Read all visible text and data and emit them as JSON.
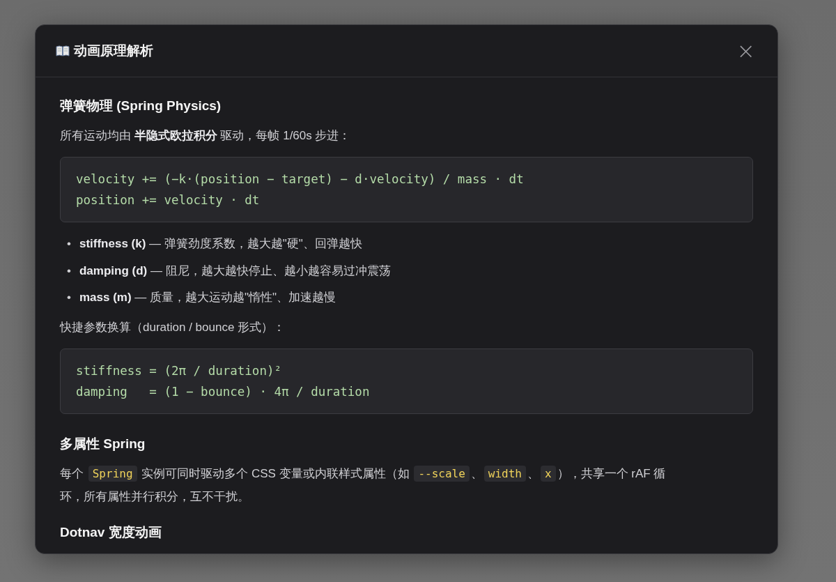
{
  "dialog": {
    "title": "动画原理解析",
    "close": "×"
  },
  "content": [
    {
      "kind": "heading",
      "text": "弹簧物理 (Spring Physics)"
    },
    {
      "kind": "paragraph",
      "text": "所有运动均由 **半隐式欧拉积分** 驱动，每帧 1/60s 步进："
    },
    {
      "kind": "code",
      "lines": [
        "velocity += (−k·(position − target) − d·velocity) / mass · dt",
        "position += velocity · dt"
      ]
    },
    {
      "kind": "list",
      "bullet": "•",
      "items": [
        "**stiffness (k)** — 弹簧劲度系数，越大越\"硬\"、回弹越快",
        "**damping (d)** — 阻尼，越大越快停止、越小越容易过冲震荡",
        "**mass (m)** — 质量，越大运动越\"惰性\"、加速越慢"
      ]
    },
    {
      "kind": "paragraph",
      "text": "快捷参数换算（duration / bounce 形式）："
    },
    {
      "kind": "code",
      "lines": [
        "stiffness = (2π / duration)²",
        "damping   = (1 − bounce) · 4π / duration"
      ]
    },
    {
      "kind": "heading",
      "text": "多属性 Spring"
    },
    {
      "kind": "mixed",
      "parts": [
        {
          "kind": "text",
          "text": "每个 "
        },
        {
          "kind": "code",
          "text": "Spring"
        },
        {
          "kind": "text",
          "text": " 实例可同时驱动多个 CSS 变量或内联样式属性（如 "
        },
        {
          "kind": "code",
          "text": "--scale"
        },
        {
          "kind": "text",
          "text": "、"
        },
        {
          "kind": "code",
          "text": "width"
        },
        {
          "kind": "text",
          "text": "、"
        },
        {
          "kind": "code",
          "text": "x"
        },
        {
          "kind": "text",
          "text": "），共享一个 rAF 循"
        },
        {
          "kind": "text",
          "text": "环，所有属性并行积分，互不干扰。"
        }
      ]
    },
    {
      "kind": "heading",
      "text": "Dotnav 宽度动画"
    }
  ]
}
